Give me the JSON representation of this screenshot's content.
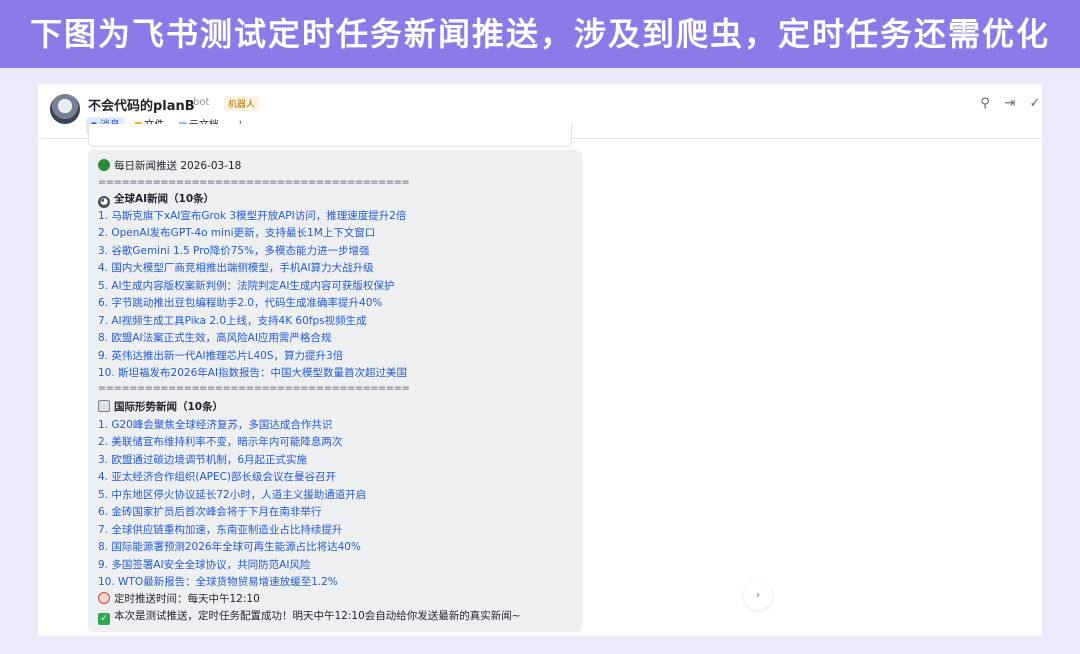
{
  "banner": {
    "text": "下图为飞书测试定时任务新闻推送，涉及到爬虫，定时任务还需优化"
  },
  "chat": {
    "title": "不会代码的planB",
    "bot_tag": "bot",
    "robot_tag": "机器人",
    "tabs": [
      {
        "label": "消息",
        "icon": "message-icon"
      },
      {
        "label": "文件",
        "icon": "folder-icon"
      },
      {
        "label": "云文档",
        "icon": "doc-icon"
      }
    ],
    "add_tab": "+",
    "header_icons": [
      "search-person-icon",
      "forward-icon",
      "check-icon"
    ]
  },
  "message": {
    "header": "每日新闻推送 2026-03-18",
    "separator": "========================================",
    "sections": [
      {
        "title": "全球AI新闻（10条）",
        "icon": "cat-icon",
        "items": [
          "1.  马斯克旗下xAI宣布Grok 3模型开放API访问，推理速度提升2倍",
          "2.  OpenAI发布GPT-4o mini更新，支持最长1M上下文窗口",
          "3.  谷歌Gemini 1.5 Pro降价75%，多模态能力进一步增强",
          "4.  国内大模型厂商竞相推出端侧模型，手机AI算力大战升级",
          "5.  AI生成内容版权案新判例：法院判定AI生成内容可获版权保护",
          "6.  字节跳动推出豆包编程助手2.0，代码生成准确率提升40%",
          "7.  AI视频生成工具Pika 2.0上线，支持4K 60fps视频生成",
          "8.  欧盟AI法案正式生效，高风险AI应用需严格合规",
          "9.  英伟达推出新一代AI推理芯片L40S，算力提升3倍",
          "10.  斯坦福发布2026年AI指数报告：中国大模型数量首次超过美国"
        ]
      },
      {
        "title": "国际形势新闻（10条）",
        "icon": "newspaper-icon",
        "items": [
          "1.  G20峰会聚焦全球经济复苏，多国达成合作共识",
          "2.  美联储宣布维持利率不变，暗示年内可能降息两次",
          "3.  欧盟通过碳边境调节机制，6月起正式实施",
          "4.  亚太经济合作组织(APEC)部长级会议在曼谷召开",
          "5.  中东地区停火协议延长72小时，人道主义援助通道开启",
          "6.  金砖国家扩员后首次峰会将于下月在南非举行",
          "7.  全球供应链重构加速，东南亚制造业占比持续提升",
          "8.  国际能源署预测2026年全球可再生能源占比将达40%",
          "9.  多国签署AI安全全球协议，共同防范AI风险",
          "10.  WTO最新报告：全球货物贸易增速放缓至1.2%"
        ]
      }
    ],
    "schedule": "定时推送时间：每天中午12:10",
    "footer": "本次是测试推送，定时任务配置成功！明天中午12:10会自动给你发送最新的真实新闻~"
  },
  "scroll_button": "›"
}
